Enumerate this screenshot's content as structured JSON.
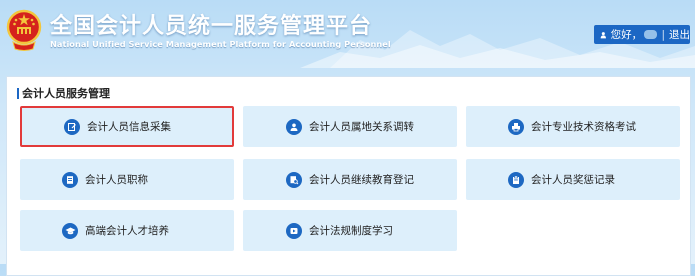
{
  "header": {
    "title_cn": "全国会计人员统一服务管理平台",
    "title_en": "National Unified Service Management Platform for Accounting Personnel",
    "user": {
      "greeting": "您好，",
      "separator": "|",
      "logout_label": "退出"
    }
  },
  "main": {
    "section_title": "会计人员服务管理",
    "tiles": [
      {
        "label": "会计人员信息采集",
        "icon": "edit-form-icon",
        "selected": true
      },
      {
        "label": "会计人员属地关系调转",
        "icon": "person-transfer-icon",
        "selected": false
      },
      {
        "label": "会计专业技术资格考试",
        "icon": "printer-icon",
        "selected": false
      },
      {
        "label": "会计人员职称",
        "icon": "document-icon",
        "selected": false
      },
      {
        "label": "会计人员继续教育登记",
        "icon": "search-document-icon",
        "selected": false
      },
      {
        "label": "会计人员奖惩记录",
        "icon": "clipboard-icon",
        "selected": false
      },
      {
        "label": "高端会计人才培养",
        "icon": "graduation-cap-icon",
        "selected": false
      },
      {
        "label": "会计法规制度学习",
        "icon": "video-play-icon",
        "selected": false
      }
    ]
  },
  "colors": {
    "accent": "#1c67c4",
    "tile_bg": "#ddeffb",
    "selected_border": "#e23a3a",
    "emblem_red": "#d5221c",
    "emblem_gold": "#f3c63c"
  }
}
